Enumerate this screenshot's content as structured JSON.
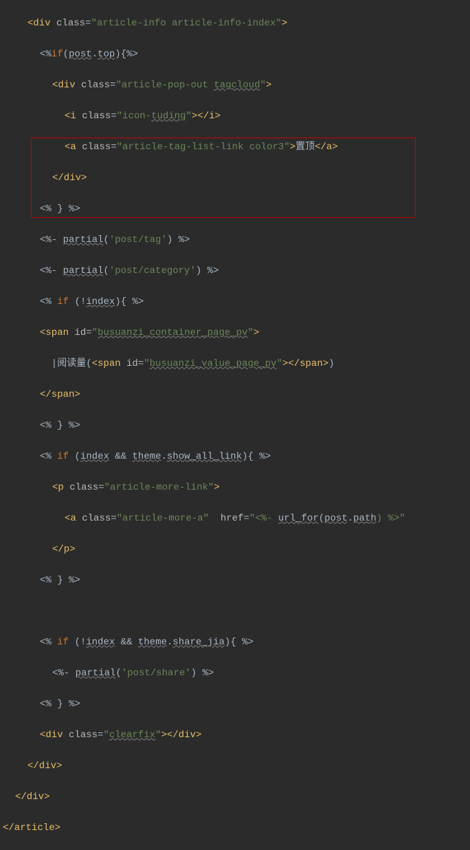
{
  "code": {
    "l1_open": "<div ",
    "l1_class": "class",
    "l1_eq": "=",
    "l1_val": "\"article-info article-info-index\"",
    "l1_close": ">",
    "l2": "<%",
    "l2_if": "if",
    "l2_cond": "(post.top){%>",
    "l2_post": "post",
    "l2_top": "top",
    "l3_open": "<div ",
    "l3_val": "\"article-pop-out ",
    "l3_tagcloud": "tagcloud",
    "l3_end": "\"",
    "l4_open": "<i ",
    "l4_val": "\"icon-",
    "l4_tuding": "tuding",
    "l4_close": "></i>",
    "l5_open": "<a ",
    "l5_val": "\"article-tag-list-link color3\"",
    "l5_text": "置顶",
    "l5_close": "</a>",
    "l6": "</div>",
    "l7": "<% } %>",
    "l8_a": "<%- ",
    "l8_partial": "partial",
    "l8_b": "(",
    "l8_arg": "'post/tag'",
    "l8_c": ") %>",
    "l9_arg": "'post/category'",
    "l10_a": "<% ",
    "l10_if": "if ",
    "l10_b": "(!",
    "l10_index": "index",
    "l10_c": "){ %>",
    "l11_open": "<span ",
    "l11_id": "id",
    "l11_val": "\"",
    "l11_busuanzi": "busuanzi_container_page_pv",
    "l12_text": "  |阅读量(",
    "l12_open": "<span ",
    "l12_busuanzi": "busuanzi_value_page_pv",
    "l12_close": "></span>",
    "l12_end": ")",
    "l13": "</span>",
    "l14": "<% } %>",
    "l15_a": "<% ",
    "l15_if": "if ",
    "l15_b": "(",
    "l15_index": "index",
    "l15_amp": " && ",
    "l15_theme": "theme",
    "l15_dot": ".",
    "l15_show": "show_all_link",
    "l15_c": "){ %>",
    "l16_open": "<p ",
    "l16_val": "\"article-more-link\"",
    "l17_open": "<a ",
    "l17_val": "\"article-more-a\"",
    "l17_href": "href",
    "l17_hval": "\"<%- ",
    "l17_url": "url_for",
    "l17_b": "(",
    "l17_post": "post",
    "l17_path": "path",
    "l17_c": ") %>\"",
    "l18": "</p>",
    "l19": "<% } %>",
    "l20_b": "(!",
    "l20_sharejia": "share_jia",
    "l21_arg": "'post/share'",
    "l22": "<% } %>",
    "l23_open": "<div ",
    "l23_val": "\"",
    "l23_clearfix": "clearfix",
    "l23_close": "></div>",
    "l24": "</div>",
    "l25": "</div>",
    "l26": "</article>"
  }
}
